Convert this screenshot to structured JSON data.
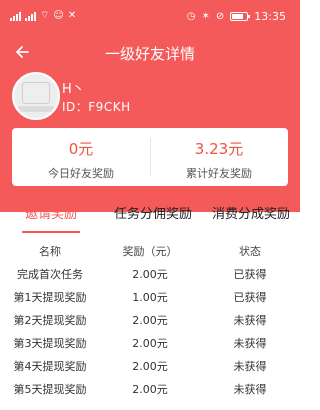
{
  "status_bar": {
    "time": "13:35",
    "left_glyphs": [
      "wifi-icon",
      "notification-icon",
      "app-icon"
    ],
    "right_glyphs": [
      "alarm-icon",
      "mute-icon",
      "do-not-disturb-icon"
    ],
    "battery_level": 0.8
  },
  "nav": {
    "title": "一级好友详情",
    "back_icon": "arrow-left-icon"
  },
  "profile": {
    "nickname": "H丶",
    "user_id": "ID：F9CKH"
  },
  "stats": {
    "today": {
      "value": "0元",
      "label": "今日好友奖励"
    },
    "total": {
      "value": "3.23元",
      "label": "累计好友奖励"
    }
  },
  "tabs": [
    {
      "label": "邀请奖励",
      "active": true
    },
    {
      "label": "任务分佣奖励",
      "active": false
    },
    {
      "label": "消费分成奖励",
      "active": false
    }
  ],
  "table": {
    "headers": [
      "名称",
      "奖励（元）",
      "状态"
    ],
    "rows": [
      [
        "完成首次任务",
        "2.00元",
        "已获得"
      ],
      [
        "第1天提现奖励",
        "1.00元",
        "已获得"
      ],
      [
        "第2天提现奖励",
        "2.00元",
        "未获得"
      ],
      [
        "第3天提现奖励",
        "2.00元",
        "未获得"
      ],
      [
        "第4天提现奖励",
        "2.00元",
        "未获得"
      ],
      [
        "第5天提现奖励",
        "2.00元",
        "未获得"
      ]
    ]
  },
  "colors": {
    "accent": "#f45a5a",
    "value": "#f4523f"
  }
}
